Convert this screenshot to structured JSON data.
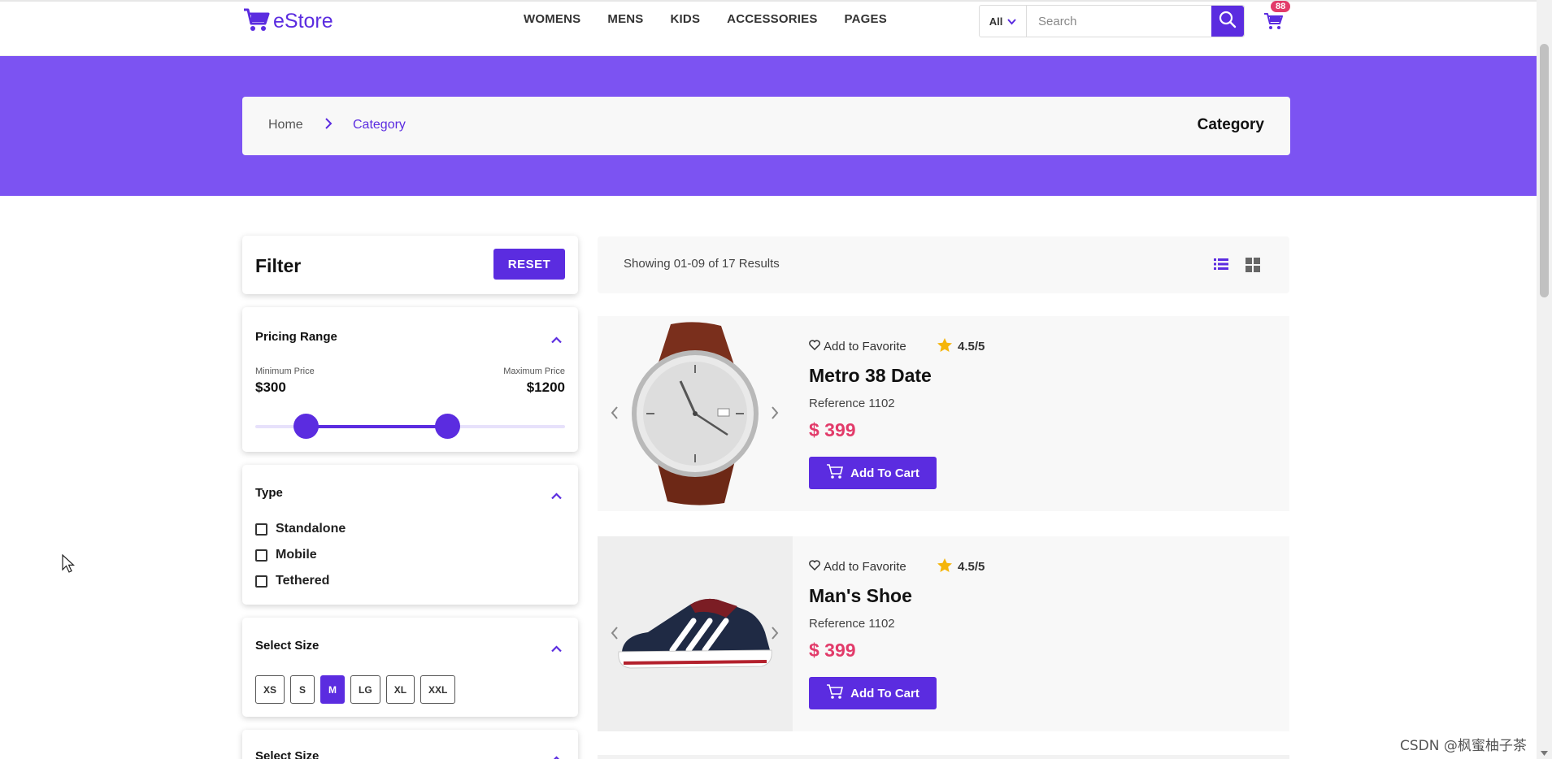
{
  "header": {
    "logo_text": "eStore",
    "nav": [
      "WOMENS",
      "MENS",
      "KIDS",
      "ACCESSORIES",
      "PAGES"
    ],
    "search": {
      "category": "All",
      "placeholder": "Search"
    },
    "cart_count": "88"
  },
  "breadcrumb": {
    "home": "Home",
    "current": "Category",
    "title": "Category"
  },
  "filter": {
    "title": "Filter",
    "reset_label": "RESET",
    "pricing": {
      "title": "Pricing Range",
      "min_label": "Minimum Price",
      "max_label": "Maximum Price",
      "min_value": "$300",
      "max_value": "$1200",
      "slider_min_fraction": 0.165,
      "slider_max_fraction": 0.62
    },
    "type": {
      "title": "Type",
      "options": [
        "Standalone",
        "Mobile",
        "Tethered"
      ]
    },
    "size": {
      "title": "Select Size",
      "options": [
        "XS",
        "S",
        "M",
        "LG",
        "XL",
        "XXL"
      ],
      "selected": "M"
    },
    "next_section_title": "Select Size"
  },
  "results": {
    "summary": "Showing 01-09 of 17 Results"
  },
  "products": [
    {
      "favorite_label": "Add to Favorite",
      "rating": "4.5/5",
      "name": "Metro 38 Date",
      "reference": "Reference 1102",
      "price": "$ 399",
      "cart_label": "Add To Cart",
      "image": "wristwatch"
    },
    {
      "favorite_label": "Add to Favorite",
      "rating": "4.5/5",
      "name": "Man's Shoe",
      "reference": "Reference 1102",
      "price": "$ 399",
      "cart_label": "Add To Cart",
      "image": "sneaker"
    }
  ],
  "watermark": "CSDN @枫蜜柚子茶",
  "colors": {
    "accent": "#5b2ce0",
    "hero": "#7c53f2",
    "price": "#e23b6a",
    "star": "#f5b50a"
  },
  "icons": [
    "cart-icon",
    "search-icon",
    "chevron-down-icon",
    "chevron-right-icon",
    "chevron-up-icon",
    "list-view-icon",
    "grid-view-icon",
    "heart-icon",
    "star-icon",
    "chevron-left-icon"
  ]
}
